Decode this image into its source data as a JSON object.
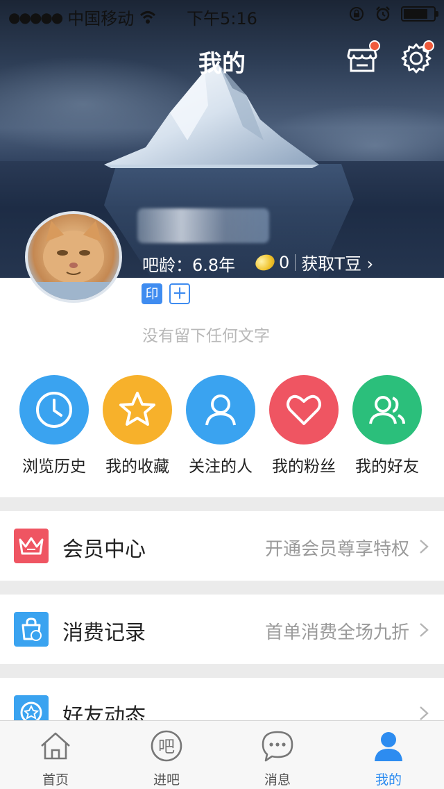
{
  "status_bar": {
    "signal": "●●●●●",
    "carrier": "中国移动",
    "time": "下午5:16"
  },
  "header": {
    "title": "我的"
  },
  "profile": {
    "ba_age": "吧龄：6.8年",
    "tdou_count": "0",
    "get_tdou": "获取T豆 ›",
    "tag_yin": "印",
    "tag_plus": "+",
    "signature": "没有留下任何文字"
  },
  "quick_actions": [
    {
      "label": "浏览历史",
      "icon": "clock-icon",
      "color": "#3aa3f0"
    },
    {
      "label": "我的收藏",
      "icon": "star-icon",
      "color": "#f7b12b"
    },
    {
      "label": "关注的人",
      "icon": "person-icon",
      "color": "#3aa3f0"
    },
    {
      "label": "我的粉丝",
      "icon": "heart-icon",
      "color": "#ef5562"
    },
    {
      "label": "我的好友",
      "icon": "friends-icon",
      "color": "#2bbf7b"
    }
  ],
  "menu_rows": [
    {
      "title": "会员中心",
      "subtitle": "开通会员尊享特权",
      "icon": "crown-icon",
      "color": "#ef5562"
    },
    {
      "title": "消费记录",
      "subtitle": "首单消费全场九折",
      "icon": "shopping-bag-icon",
      "color": "#3aa3f0"
    },
    {
      "title": "好友动态",
      "subtitle": "",
      "icon": "star-badge-icon",
      "color": "#3aa3f0"
    }
  ],
  "tab_bar": [
    {
      "label": "首页",
      "icon": "home-icon"
    },
    {
      "label": "进吧",
      "icon": "ba-icon"
    },
    {
      "label": "消息",
      "icon": "chat-icon"
    },
    {
      "label": "我的",
      "icon": "person-filled-icon",
      "active": true
    }
  ],
  "colors": {
    "accent": "#2d8cf0",
    "notification_dot": "#f05a3a"
  }
}
